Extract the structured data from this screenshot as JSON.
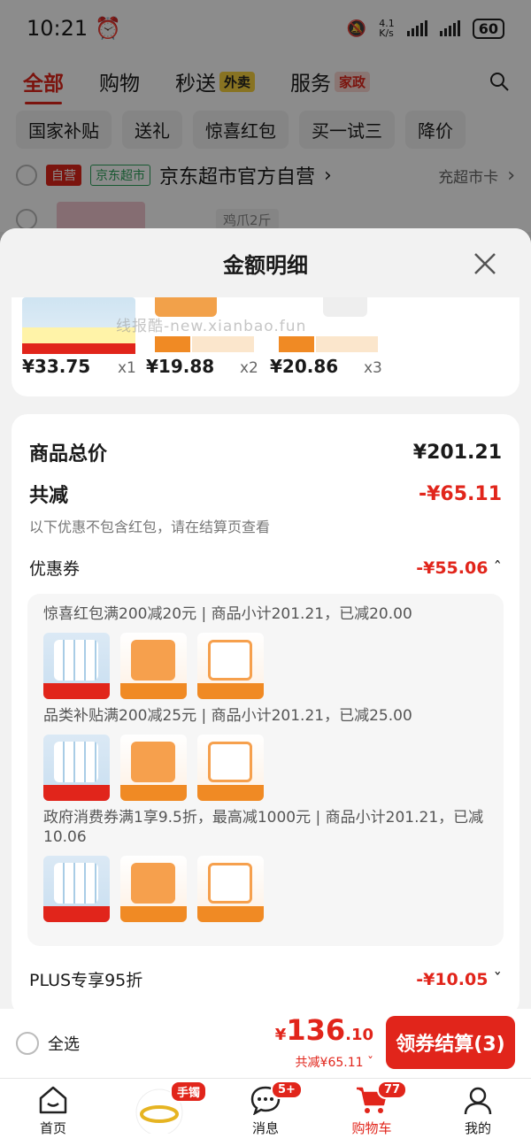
{
  "status_bar": {
    "time": "10:21",
    "net_speed": "4.1\nK/s",
    "battery": "60"
  },
  "top_nav": {
    "tabs": [
      {
        "label": "全部",
        "active": true
      },
      {
        "label": "购物"
      },
      {
        "label": "秒送",
        "badge": "外卖"
      },
      {
        "label": "服务",
        "badge": "家政"
      }
    ]
  },
  "filters": [
    "国家补贴",
    "送礼",
    "惊喜红包",
    "买一试三",
    "降价"
  ],
  "store": {
    "tag_self": "自营",
    "tag_market": "京东超市",
    "name": "京东超市官方自营",
    "link": "充超市卡",
    "variant": "鸡爪2斤"
  },
  "sheet": {
    "title": "金额明细",
    "watermark": "线报酷-new.xianbao.fun",
    "items": [
      {
        "price": "¥33.75",
        "qty": "x1"
      },
      {
        "price": "¥19.88",
        "qty": "x2"
      },
      {
        "price": "¥20.86",
        "qty": "x3"
      }
    ],
    "summary": {
      "total_label": "商品总价",
      "total_value": "¥201.21",
      "discount_label": "共减",
      "discount_value": "-¥65.11",
      "note": "以下优惠不包含红包，请在结算页查看",
      "coupon_label": "优惠券",
      "coupon_value": "-¥55.06",
      "promos": [
        "惊喜红包满200减20元 | 商品小计201.21，已减20.00",
        "品类补贴满200减25元 | 商品小计201.21，已减25.00",
        "政府消费券满1享9.5折，最高减1000元 | 商品小计201.21，已减10.06"
      ],
      "plus_label": "PLUS专享95折",
      "plus_value": "-¥10.05"
    }
  },
  "bottom_bar": {
    "select_all": "全选",
    "total_yuan": "136",
    "total_cents": ".10",
    "total_symbol": "¥",
    "saved": "共减¥65.11",
    "checkout": "领券结算(3)"
  },
  "tab_bar": [
    {
      "label": "首页"
    },
    {
      "label": "",
      "badge": "手镯"
    },
    {
      "label": "消息",
      "badge": "5+"
    },
    {
      "label": "购物车",
      "badge": "77",
      "active": true
    },
    {
      "label": "我的"
    }
  ],
  "colors": {
    "accent": "#e1251b"
  }
}
